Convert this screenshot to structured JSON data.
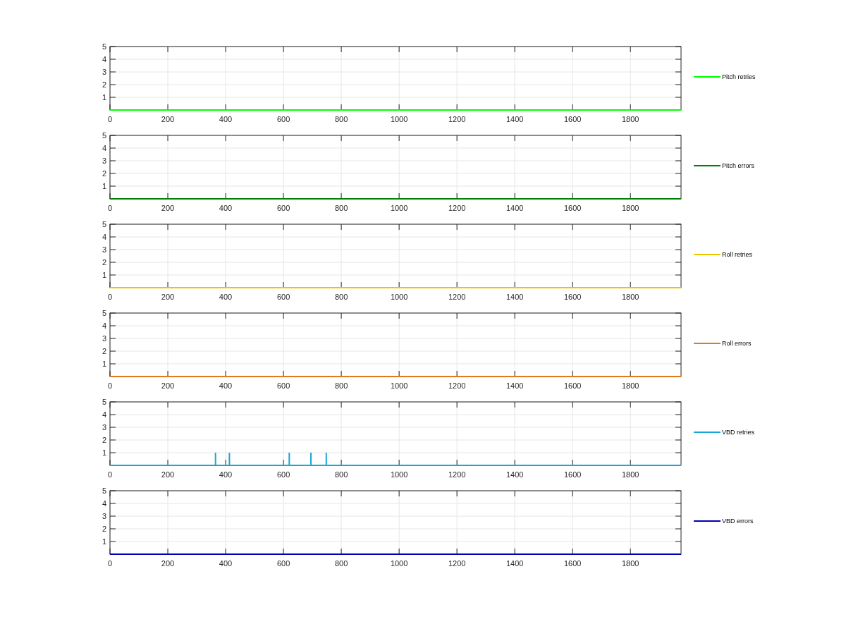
{
  "charts": [
    {
      "chart_data": {
        "type": "line",
        "grid": true,
        "x": [
          0,
          1975
        ],
        "series": [
          {
            "name": "Pitch retries",
            "color": "#00ff00",
            "values": [
              0,
              0
            ]
          }
        ],
        "xlim": [
          0,
          1975
        ],
        "ylim": [
          0,
          5
        ],
        "xticks": [
          0,
          200,
          400,
          600,
          800,
          1000,
          1200,
          1400,
          1600,
          1800
        ],
        "yticks": [
          1,
          2,
          3,
          4,
          5
        ]
      }
    },
    {
      "chart_data": {
        "type": "line",
        "grid": true,
        "x": [
          0,
          1975
        ],
        "series": [
          {
            "name": "Pitch errors",
            "color": "#007f00",
            "values": [
              0,
              0
            ]
          }
        ],
        "xlim": [
          0,
          1975
        ],
        "ylim": [
          0,
          5
        ],
        "xticks": [
          0,
          200,
          400,
          600,
          800,
          1000,
          1200,
          1400,
          1600,
          1800
        ],
        "yticks": [
          1,
          2,
          3,
          4,
          5
        ]
      }
    },
    {
      "chart_data": {
        "type": "line",
        "grid": true,
        "x": [
          0,
          1975
        ],
        "series": [
          {
            "name": "Roll retries",
            "color": "#edc400",
            "values": [
              0,
              0
            ]
          }
        ],
        "xlim": [
          0,
          1975
        ],
        "ylim": [
          0,
          5
        ],
        "xticks": [
          0,
          200,
          400,
          600,
          800,
          1000,
          1200,
          1400,
          1600,
          1800
        ],
        "yticks": [
          1,
          2,
          3,
          4,
          5
        ]
      }
    },
    {
      "chart_data": {
        "type": "line",
        "grid": true,
        "x": [
          0,
          1975
        ],
        "series": [
          {
            "name": "Roll errors",
            "color": "#e07a1f",
            "values": [
              0,
              0
            ]
          }
        ],
        "xlim": [
          0,
          1975
        ],
        "ylim": [
          0,
          5
        ],
        "xticks": [
          0,
          200,
          400,
          600,
          800,
          1000,
          1200,
          1400,
          1600,
          1800
        ],
        "yticks": [
          1,
          2,
          3,
          4,
          5
        ]
      }
    },
    {
      "chart_data": {
        "type": "line",
        "grid": true,
        "x": [
          0,
          365,
          365,
          365,
          413,
          413,
          413,
          620,
          620,
          620,
          695,
          695,
          695,
          748,
          748,
          748,
          1975
        ],
        "series": [
          {
            "name": "VBD retries",
            "color": "#1aa6d9",
            "values": [
              0,
              0,
              1,
              0,
              0,
              1,
              0,
              0,
              1,
              0,
              0,
              1,
              0,
              0,
              1,
              0,
              0
            ]
          }
        ],
        "xlim": [
          0,
          1975
        ],
        "ylim": [
          0,
          5
        ],
        "xticks": [
          0,
          200,
          400,
          600,
          800,
          1000,
          1200,
          1400,
          1600,
          1800
        ],
        "yticks": [
          1,
          2,
          3,
          4,
          5
        ]
      }
    },
    {
      "chart_data": {
        "type": "line",
        "grid": true,
        "x": [
          0,
          1975
        ],
        "series": [
          {
            "name": "VBD errors",
            "color": "#0000b3",
            "values": [
              0,
              0
            ]
          }
        ],
        "xlim": [
          0,
          1975
        ],
        "ylim": [
          0,
          5
        ],
        "xticks": [
          0,
          200,
          400,
          600,
          800,
          1000,
          1200,
          1400,
          1600,
          1800
        ],
        "yticks": [
          1,
          2,
          3,
          4,
          5
        ]
      }
    }
  ]
}
